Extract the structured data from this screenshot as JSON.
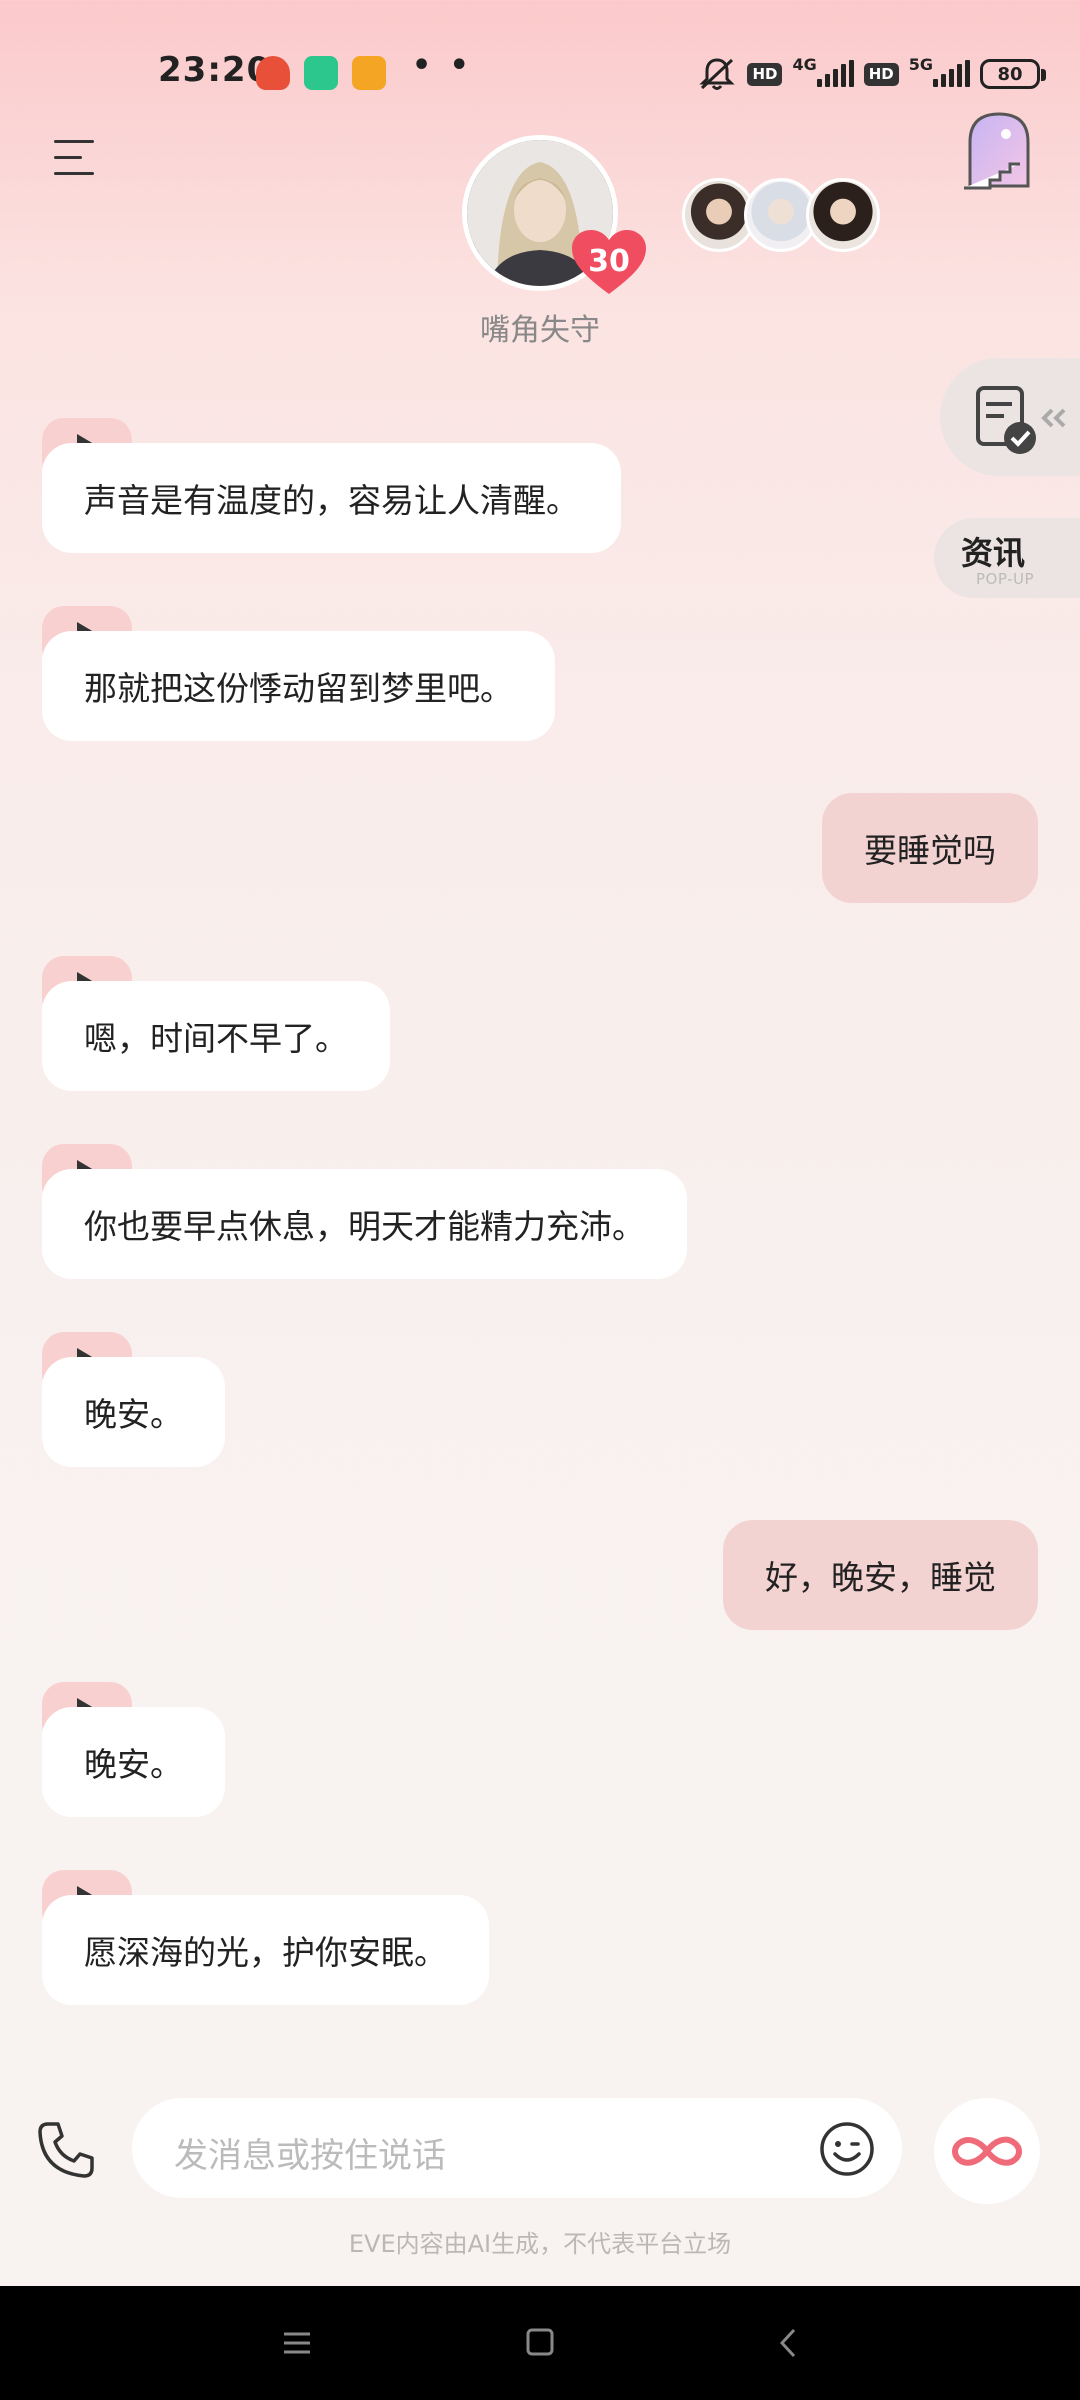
{
  "status_bar": {
    "time": "23:20",
    "net_left": "4G",
    "net_right": "5G",
    "hd_label": "HD",
    "battery": "80",
    "more_dots": "• •"
  },
  "header": {
    "character_name": "嘴角失守",
    "intimacy_level": "30"
  },
  "side_panel": {
    "news_title": "资讯",
    "news_subtitle": "POP-UP"
  },
  "messages": [
    {
      "from": "ai",
      "text": "声音是有温度的，容易让人清醒。"
    },
    {
      "from": "ai",
      "text": "那就把这份悸动留到梦里吧。"
    },
    {
      "from": "me",
      "text": "要睡觉吗"
    },
    {
      "from": "ai",
      "text": "嗯，时间不早了。"
    },
    {
      "from": "ai",
      "text": "你也要早点休息，明天才能精力充沛。"
    },
    {
      "from": "ai",
      "text": "晚安。"
    },
    {
      "from": "me",
      "text": "好，晚安，睡觉"
    },
    {
      "from": "ai",
      "text": "晚安。"
    },
    {
      "from": "ai",
      "text": "愿深海的光，护你安眠。"
    }
  ],
  "input": {
    "placeholder": "发消息或按住说话"
  },
  "disclaimer": "EVE内容由AI生成，不代表平台立场",
  "colors": {
    "accent": "#f06b7a",
    "bubble_me": "#f3d3d2",
    "bubble_ai": "#ffffff",
    "play_tab": "#f9d0d0"
  },
  "icons": [
    "menu-icon",
    "scene-window-icon",
    "task-icon",
    "play-icon",
    "phone-icon",
    "emoji-icon",
    "infinity-icon",
    "nav-menu-icon",
    "nav-home-icon",
    "nav-back-icon"
  ]
}
